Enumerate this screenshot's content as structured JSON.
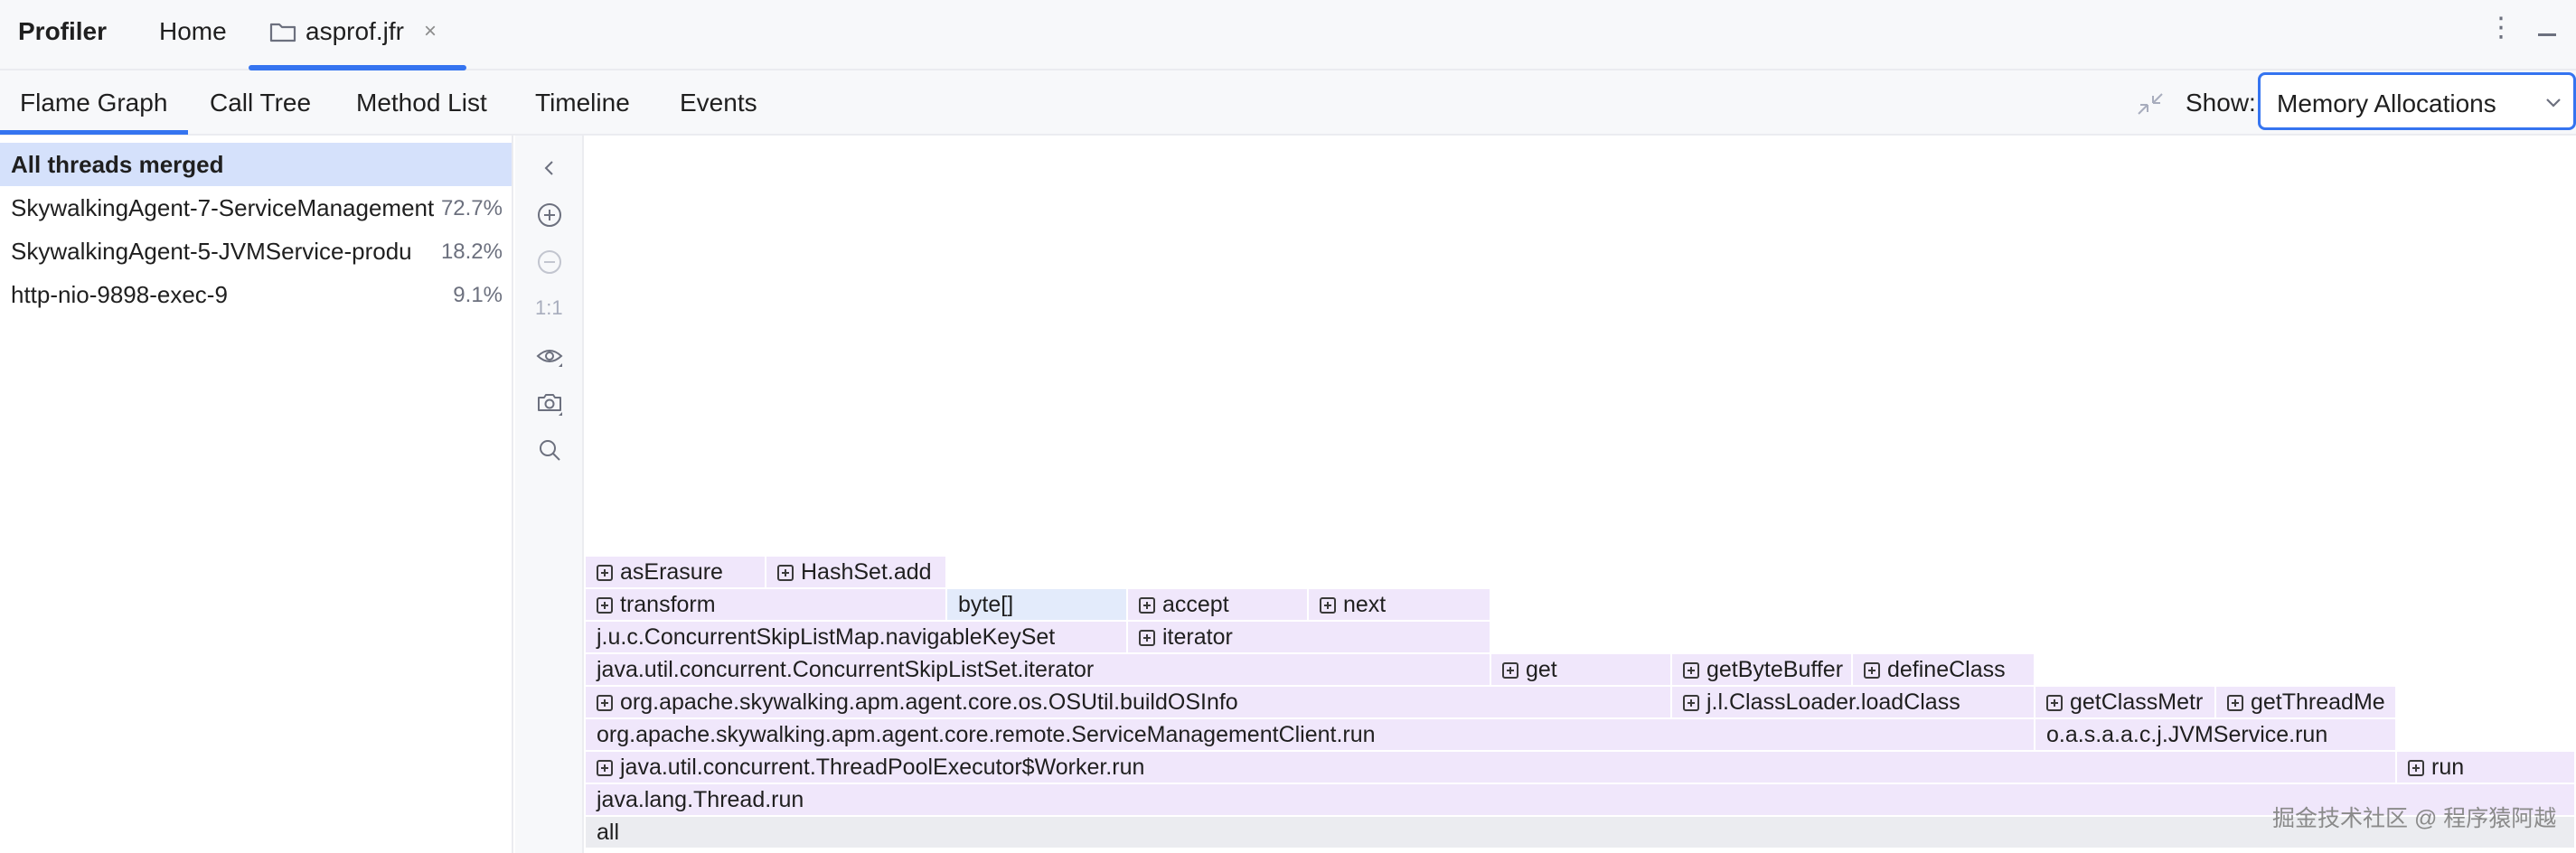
{
  "app": {
    "title": "Profiler"
  },
  "top_tabs": {
    "home": "Home",
    "file": "asprof.jfr",
    "close_glyph": "×"
  },
  "view_tabs": [
    "Flame Graph",
    "Call Tree",
    "Method List",
    "Timeline",
    "Events"
  ],
  "show": {
    "label": "Show:",
    "value": "Memory Allocations"
  },
  "threads": [
    {
      "name": "All threads merged",
      "pct": ""
    },
    {
      "name": "SkywalkingAgent-7-ServiceManagement",
      "pct": "72.7%"
    },
    {
      "name": "SkywalkingAgent-5-JVMService-produ",
      "pct": "18.2%"
    },
    {
      "name": "http-nio-9898-exec-9",
      "pct": "9.1%"
    }
  ],
  "toolbar": {
    "actual_size": "1:1"
  },
  "flame": {
    "r0": "all",
    "r1": "java.lang.Thread.run",
    "r2a": "java.util.concurrent.ThreadPoolExecutor$Worker.run",
    "r2b": "run",
    "r3a": "org.apache.skywalking.apm.agent.core.remote.ServiceManagementClient.run",
    "r3b": "o.a.s.a.a.c.j.JVMService.run",
    "r4a": "org.apache.skywalking.apm.agent.core.os.OSUtil.buildOSInfo",
    "r4b": "j.l.ClassLoader.loadClass",
    "r4c": "getClassMetr",
    "r4d": "getThreadMe",
    "r5a": "java.util.concurrent.ConcurrentSkipListSet.iterator",
    "r5b": "get",
    "r5c": "getByteBuffer",
    "r5d": "defineClass",
    "r6a": "j.u.c.ConcurrentSkipListMap.navigableKeySet",
    "r6b": "iterator",
    "r7a": "transform",
    "r7b": "byte[]",
    "r7c": "accept",
    "r7d": "next",
    "r8a": "asErasure",
    "r8b": "HashSet.add"
  },
  "watermark": "掘金技术社区 @ 程序猿阿越",
  "colors": {
    "accent": "#3574f0",
    "frame": "#f0e7fb",
    "frame_leaf": "#e3ebfb",
    "selected_row": "#d5e1fb"
  }
}
